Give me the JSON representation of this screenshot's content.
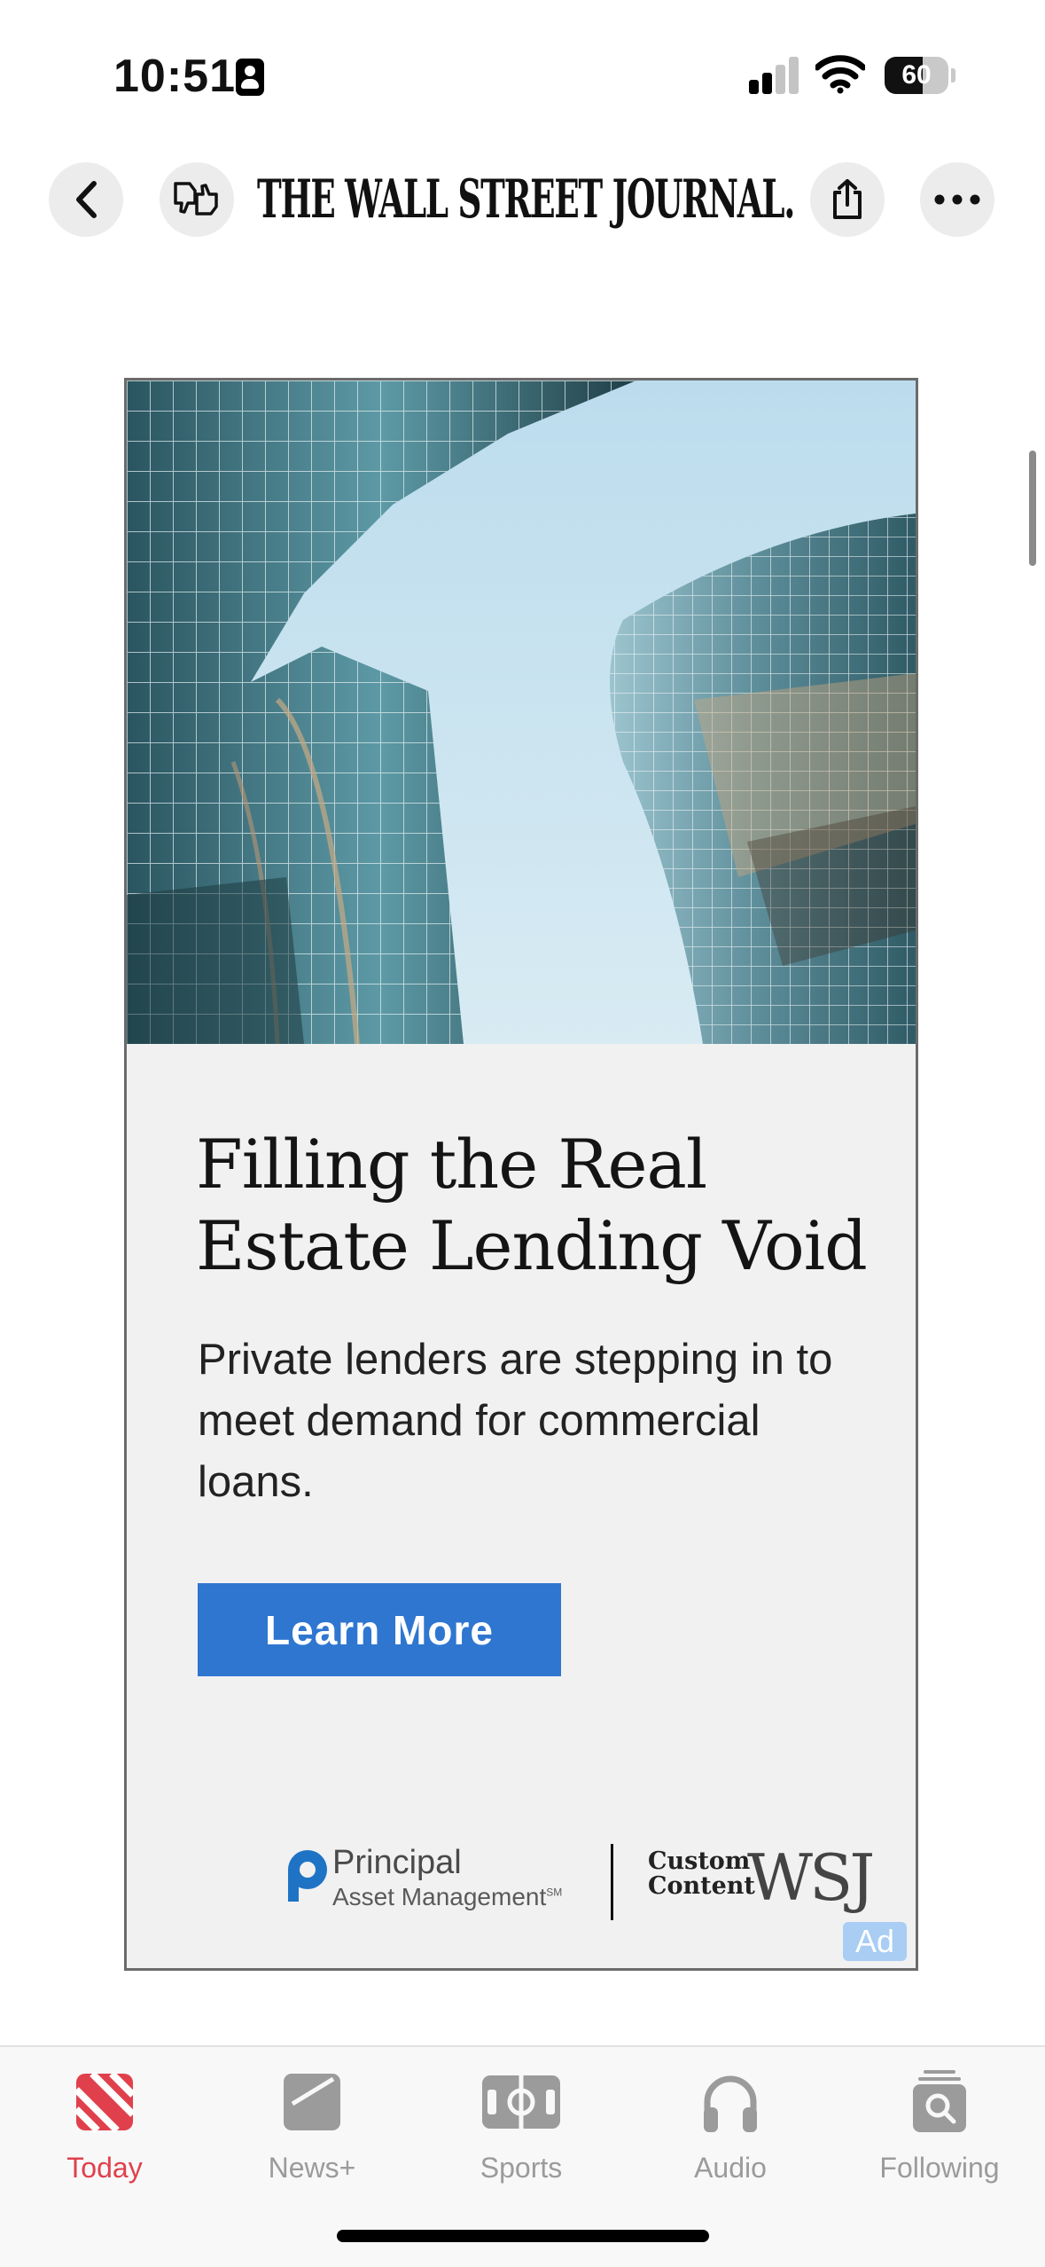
{
  "status_bar": {
    "time": "10:51",
    "battery_percent": "60",
    "battery_level": 0.6,
    "signal_bars_active": 2,
    "signal_bars_total": 4
  },
  "header": {
    "publication": "THE WALL STREET JOURNAL."
  },
  "ad": {
    "headline": "Filling the Real Estate Lending Void",
    "body": "Private lenders are stepping in to meet demand for commercial loans.",
    "cta_label": "Learn More",
    "sponsor_name": "Principal",
    "sponsor_sub": "Asset Management",
    "sponsor_mark": "SM",
    "custom_content_line1": "Custom",
    "custom_content_line2": "Content",
    "wsj_logo": "WSJ",
    "badge": "Ad"
  },
  "tab_bar": {
    "tabs": [
      {
        "label": "Today",
        "icon": "news-icon",
        "active": true
      },
      {
        "label": "News+",
        "icon": "news-plus-icon",
        "active": false
      },
      {
        "label": "Sports",
        "icon": "sports-icon",
        "active": false
      },
      {
        "label": "Audio",
        "icon": "headphones-icon",
        "active": false
      },
      {
        "label": "Following",
        "icon": "following-icon",
        "active": false
      }
    ]
  },
  "colors": {
    "active_tab": "#e0404c",
    "inactive_tab": "#9b9b9b",
    "cta_button": "#2f76d0",
    "ad_badge": "#a9cdf3"
  }
}
